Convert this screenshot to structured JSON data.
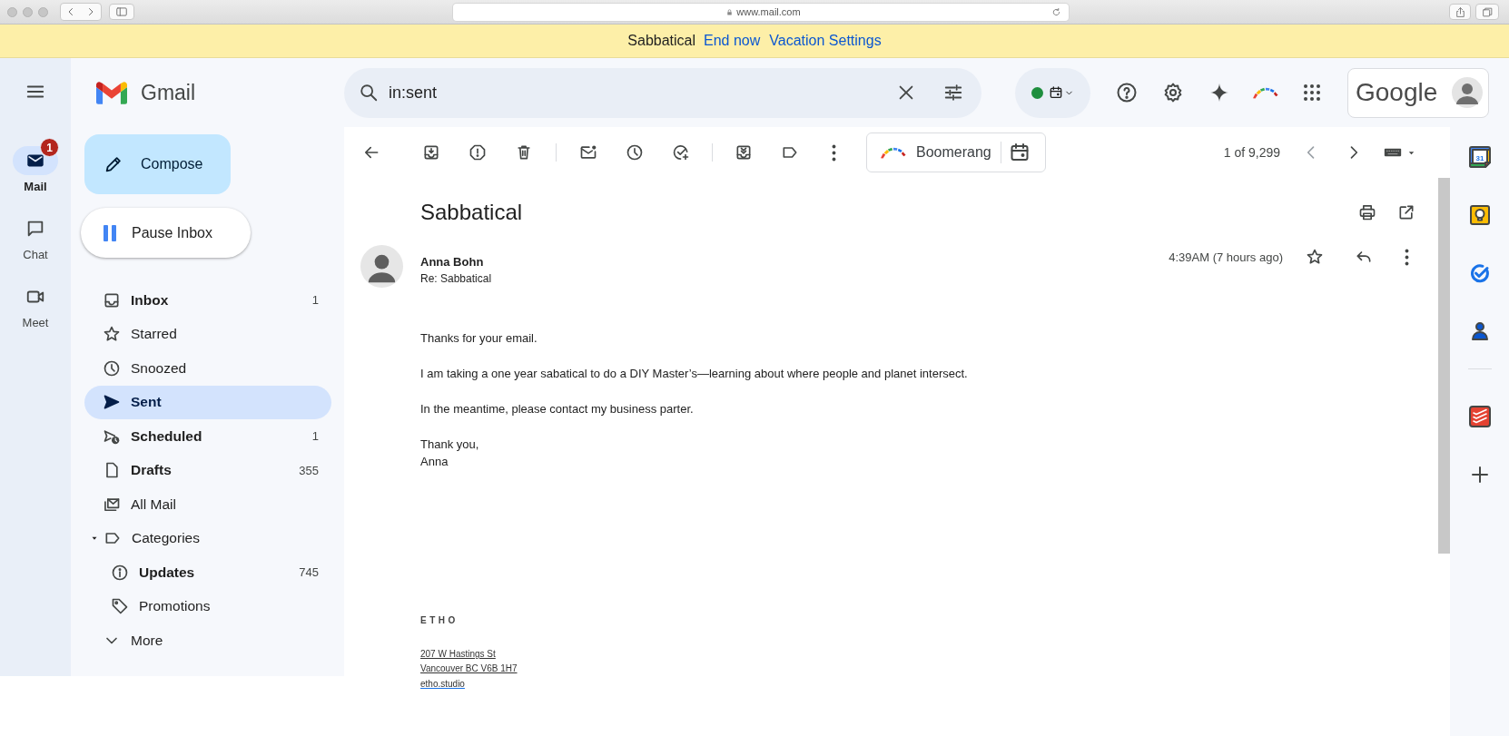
{
  "browser": {
    "url": "www.mail.com"
  },
  "banner": {
    "title": "Sabbatical",
    "links": [
      "End now",
      "Vacation Settings"
    ]
  },
  "rail": [
    {
      "label": "Mail",
      "selected": true,
      "badge": "1"
    },
    {
      "label": "Chat",
      "selected": false
    },
    {
      "label": "Meet",
      "selected": false
    }
  ],
  "header": {
    "product": "Gmail",
    "search": {
      "value": "in:sent"
    },
    "account": {
      "label": "Google"
    }
  },
  "compose": "Compose",
  "pause_inbox": "Pause Inbox",
  "nav": [
    {
      "kind": "folder",
      "label": "Inbox",
      "count": "1",
      "unread": true,
      "selected": false
    },
    {
      "kind": "folder",
      "label": "Starred",
      "unread": false,
      "selected": false
    },
    {
      "kind": "folder",
      "label": "Snoozed",
      "unread": false,
      "selected": false
    },
    {
      "kind": "folder",
      "label": "Sent",
      "unread": false,
      "selected": true
    },
    {
      "kind": "folder",
      "label": "Scheduled",
      "count": "1",
      "unread": true,
      "selected": false
    },
    {
      "kind": "folder",
      "label": "Drafts",
      "count": "355",
      "unread": true,
      "selected": false
    },
    {
      "kind": "folder",
      "label": "All Mail",
      "unread": false,
      "selected": false
    },
    {
      "kind": "group",
      "label": "Categories",
      "expanded": true,
      "unread": false,
      "selected": false,
      "children": [
        {
          "label": "Updates",
          "count": "745",
          "unread": true,
          "selected": false
        },
        {
          "label": "Promotions",
          "unread": false,
          "selected": false
        }
      ]
    },
    {
      "kind": "more",
      "label": "More",
      "unread": false,
      "selected": false
    }
  ],
  "toolbar": {
    "boomerang": "Boomerang",
    "pagination": "1 of 9,299"
  },
  "message": {
    "subject": "Sabbatical",
    "sender": "Anna Bohn",
    "subline": "Re: Sabbatical",
    "time": "4:39AM (7 hours ago)",
    "starred": false,
    "paragraphs": [
      "Thanks for your email.",
      "I am taking a one year sabatical to do a DIY Master’s—learning about where people and planet intersect.",
      "In the meantime, please contact my business parter.",
      "Thank you,\nAnna"
    ],
    "signature": {
      "brand": "ETHO",
      "address": [
        "207 W Hastings St",
        "Vancouver BC V6B 1H7"
      ],
      "website": "etho.studio"
    }
  },
  "right_rail": {
    "calendar_date": "31"
  }
}
